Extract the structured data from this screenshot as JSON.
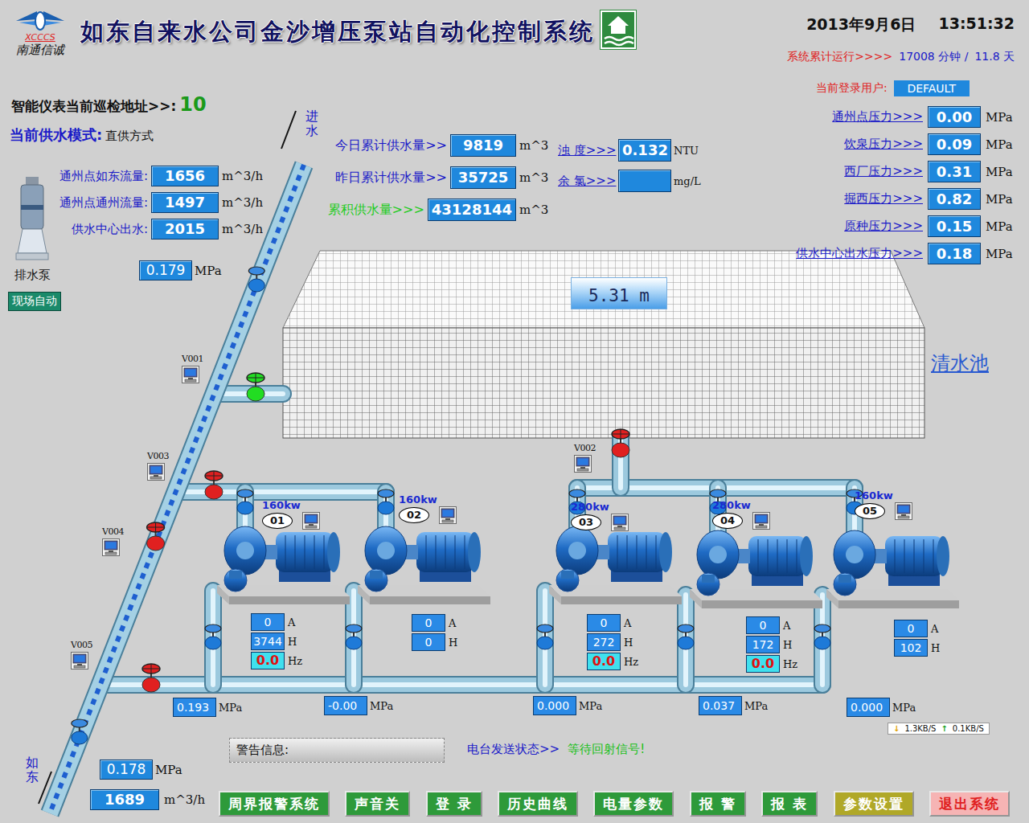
{
  "header": {
    "logo_text": "XCCCS",
    "company": "南通信诚",
    "title": "如东自来水公司金沙增压泵站自动化控制系统",
    "date": "2013年9月6日",
    "time": "13:51:32"
  },
  "runtime": {
    "label": "系统累计运行>>>>",
    "minutes": "17008 分钟 /",
    "days": "11.8 天"
  },
  "user": {
    "label": "当前登录用户:",
    "value": "DEFAULT"
  },
  "inspection": {
    "label": "智能仪表当前巡检地址>>:",
    "value": "10"
  },
  "supply_mode": {
    "label": "当前供水模式:",
    "value": "直供方式"
  },
  "inlet": {
    "label": "进水",
    "pressure": "0.179",
    "unit": "MPa"
  },
  "flows": [
    {
      "label": "通州点如东流量:",
      "value": "1656",
      "unit": "m^3/h"
    },
    {
      "label": "通州点通州流量:",
      "value": "1497",
      "unit": "m^3/h"
    },
    {
      "label": "供水中心出水:",
      "value": "2015",
      "unit": "m^3/h"
    }
  ],
  "drain_pump": {
    "label": "排水泵",
    "mode": "现场自动"
  },
  "totals": [
    {
      "label": "今日累计供水量>>",
      "value": "9819",
      "unit": "m^3",
      "color": "#1a1ac8"
    },
    {
      "label": "昨日累计供水量>>",
      "value": "35725",
      "unit": "m^3",
      "color": "#1a1ac8"
    },
    {
      "label": "累积供水量>>>",
      "value": "43128144",
      "unit": "m^3",
      "color": "#22cc22"
    }
  ],
  "quality": [
    {
      "label": "浊 度>>>",
      "value": "0.132",
      "unit": "NTU"
    },
    {
      "label": "余 氯>>>",
      "value": "",
      "unit": "mg/L"
    }
  ],
  "site_pressures": [
    {
      "label": "通州点压力>>>",
      "value": "0.00",
      "unit": "MPa"
    },
    {
      "label": "饮泉压力>>>",
      "value": "0.09",
      "unit": "MPa"
    },
    {
      "label": "西厂压力>>>",
      "value": "0.31",
      "unit": "MPa"
    },
    {
      "label": "掘西压力>>>",
      "value": "0.82",
      "unit": "MPa"
    },
    {
      "label": "原种压力>>>",
      "value": "0.15",
      "unit": "MPa"
    },
    {
      "label": "供水中心出水压力>>>",
      "value": "0.18",
      "unit": "MPa"
    }
  ],
  "tank": {
    "level_text": "5.31 m",
    "label": "清水池"
  },
  "valves": [
    {
      "label": "V001",
      "color": "#22dd22"
    },
    {
      "label": "V002",
      "color": "#e02020"
    },
    {
      "label": "V003",
      "color": "#e02020"
    },
    {
      "label": "V004",
      "color": "#e02020"
    },
    {
      "label": "V005",
      "color": "#e02020"
    }
  ],
  "pump_units": {
    "current": "A",
    "head": "H",
    "freq": "Hz",
    "pressure": "MPa"
  },
  "pumps": [
    {
      "id": "01",
      "power": "160kw",
      "kind": "vfd",
      "current": "0",
      "head": "3744",
      "freq": "0.0",
      "pressure": "0.193"
    },
    {
      "id": "02",
      "power": "160kw",
      "kind": "fixed",
      "current": "0",
      "head": "0",
      "pressure": "-0.00"
    },
    {
      "id": "03",
      "power": "280kw",
      "kind": "vfd",
      "current": "0",
      "head": "272",
      "freq": "0.0",
      "pressure": "0.000"
    },
    {
      "id": "04",
      "power": "280kw",
      "kind": "vfd",
      "current": "0",
      "head": "172",
      "freq": "0.0",
      "pressure": "0.037"
    },
    {
      "id": "05",
      "power": "160kw",
      "kind": "fixed",
      "current": "0",
      "head": "102",
      "pressure": "0.000"
    }
  ],
  "outlet": {
    "label": "如东",
    "pressure": "0.178",
    "pressure_unit": "MPa",
    "flow": "1689",
    "flow_unit": "m^3/h"
  },
  "warning": {
    "label": "警告信息:"
  },
  "radio": {
    "label": "电台发送状态>>",
    "value": "等待回射信号!"
  },
  "network": {
    "down_icon": "↓",
    "down": "1.3KB/S",
    "up_icon": "↑",
    "up": "0.1KB/S"
  },
  "buttons": [
    {
      "label": "周界报警系统",
      "color": "#2e9a3a",
      "text_color": "#ffffff"
    },
    {
      "label": "声音关",
      "color": "#2e9a3a",
      "text_color": "#ffffff"
    },
    {
      "label": "登 录",
      "color": "#2e9a3a",
      "text_color": "#ffffff"
    },
    {
      "label": "历史曲线",
      "color": "#2e9a3a",
      "text_color": "#ffffff"
    },
    {
      "label": "电量参数",
      "color": "#2e9a3a",
      "text_color": "#ffffff"
    },
    {
      "label": "报 警",
      "color": "#2e9a3a",
      "text_color": "#ffffff"
    },
    {
      "label": "报 表",
      "color": "#2e9a3a",
      "text_color": "#ffffff"
    },
    {
      "label": "参数设置",
      "color": "#b0a828",
      "text_color": "#ffffff"
    },
    {
      "label": "退出系统",
      "color": "#f6b4b4",
      "text_color": "#e02020"
    }
  ]
}
